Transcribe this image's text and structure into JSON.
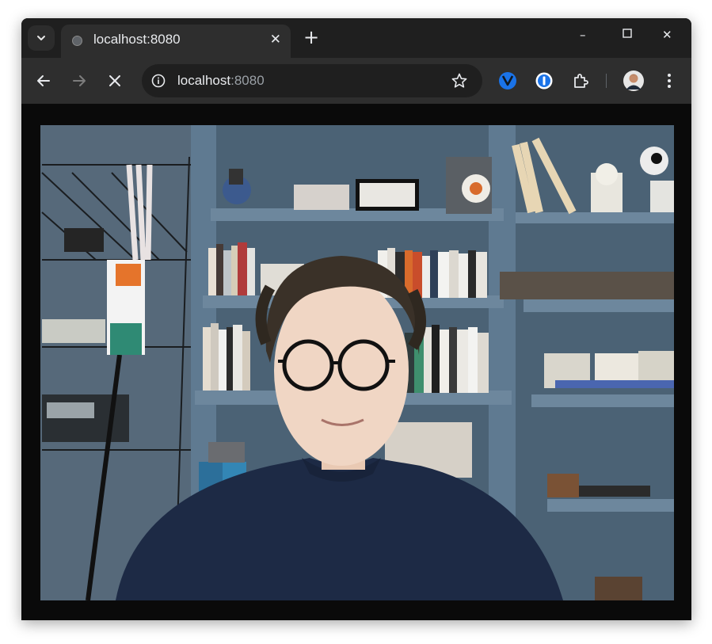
{
  "tab": {
    "title": "localhost:8080",
    "favicon_icon": "globe-icon",
    "close_label": "✕"
  },
  "tabstrip": {
    "tab_search_icon": "chevron-down-icon",
    "new_tab_label": "+"
  },
  "window_controls": {
    "minimize": "–",
    "maximize": "☐",
    "close": "✕"
  },
  "toolbar": {
    "back_icon": "arrow-left-icon",
    "forward_icon": "arrow-right-icon",
    "stop_icon": "close-icon",
    "bookmark_icon": "star-icon",
    "extensions": [
      "vpn-extension-icon",
      "password-manager-icon",
      "puzzle-icon"
    ],
    "profile_icon": "avatar",
    "menu_icon": "kebab-menu-icon"
  },
  "omnibox": {
    "host": "localhost",
    "port": ":8080",
    "info_icon": "info-icon"
  },
  "page": {
    "content": "webcam video feed",
    "background": "#0a0a0a"
  },
  "colors": {
    "chrome_dark": "#1f1f1f",
    "toolbar": "#2e2e2e",
    "text": "#e8eaed",
    "accent_blue": "#1a73e8"
  }
}
